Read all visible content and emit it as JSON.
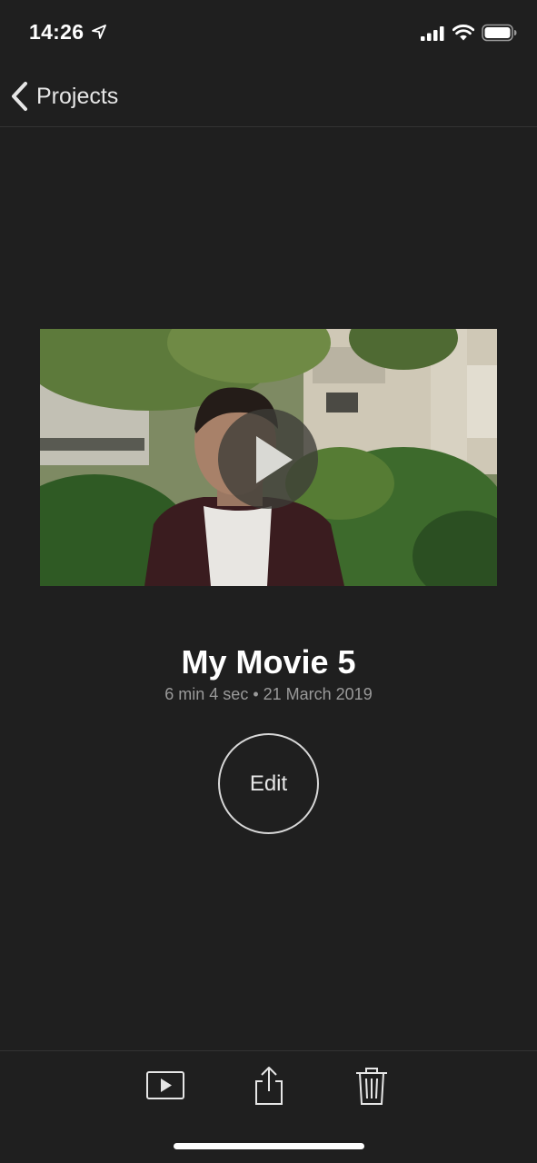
{
  "status_bar": {
    "time": "14:26",
    "icons": [
      "location-arrow-icon",
      "cellular-signal-icon",
      "wifi-icon",
      "battery-icon"
    ]
  },
  "nav": {
    "back_label": "Projects",
    "back_icon": "chevron-left-icon"
  },
  "project": {
    "title": "My Movie 5",
    "meta": "6 min 4 sec • 21 March 2019",
    "edit_label": "Edit",
    "play_icon": "play-icon"
  },
  "toolbar": {
    "items": [
      "play-fullscreen-icon",
      "share-icon",
      "trash-icon"
    ]
  },
  "colors": {
    "background": "#1f1f1f",
    "meta_text": "#9a9a9a",
    "divider": "#333333"
  }
}
